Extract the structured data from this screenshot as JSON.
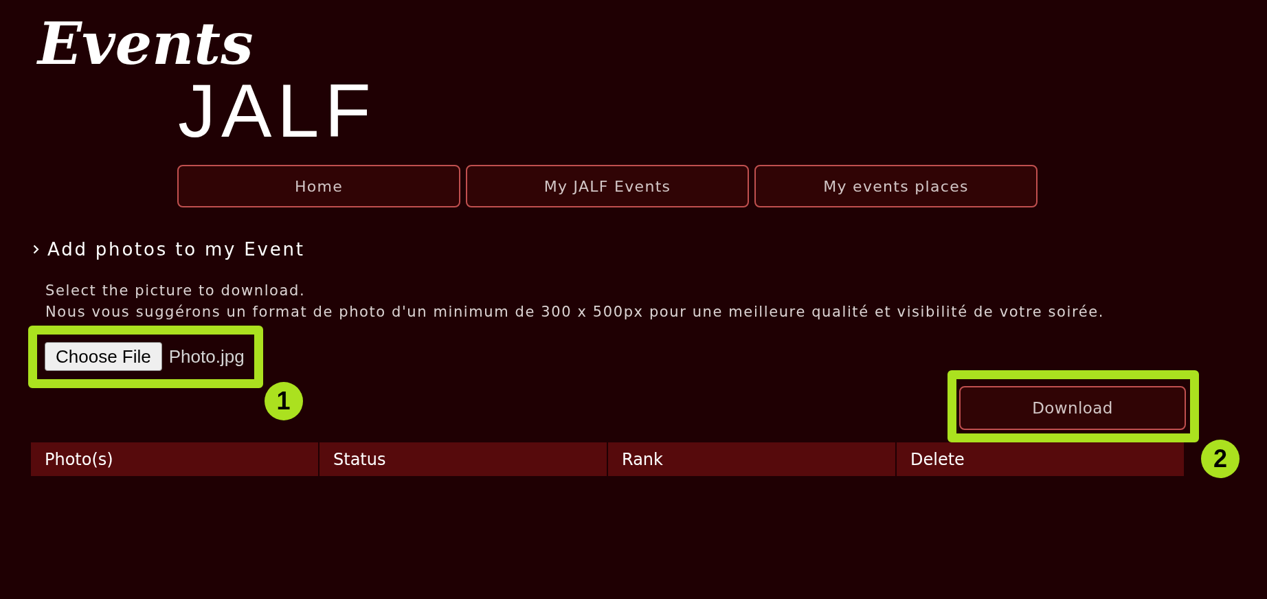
{
  "logo": {
    "script": "Events",
    "wordmark": "JALF"
  },
  "nav": [
    {
      "label": "Home"
    },
    {
      "label": "My JALF Events"
    },
    {
      "label": "My events places"
    }
  ],
  "section": {
    "title": "Add photos to my Event",
    "instructions": [
      "Select the picture to download.",
      "Nous vous suggérons un format de photo d'un minimum de 300 x 500px pour une meilleure qualité et visibilité de votre soirée."
    ]
  },
  "file_input": {
    "button": "Choose File",
    "value": "Photo.jpg",
    "callout": "1"
  },
  "download": {
    "label": "Download",
    "callout": "2"
  },
  "table": {
    "columns": [
      "Photo(s)",
      "Status",
      "Rank",
      "Delete"
    ]
  }
}
